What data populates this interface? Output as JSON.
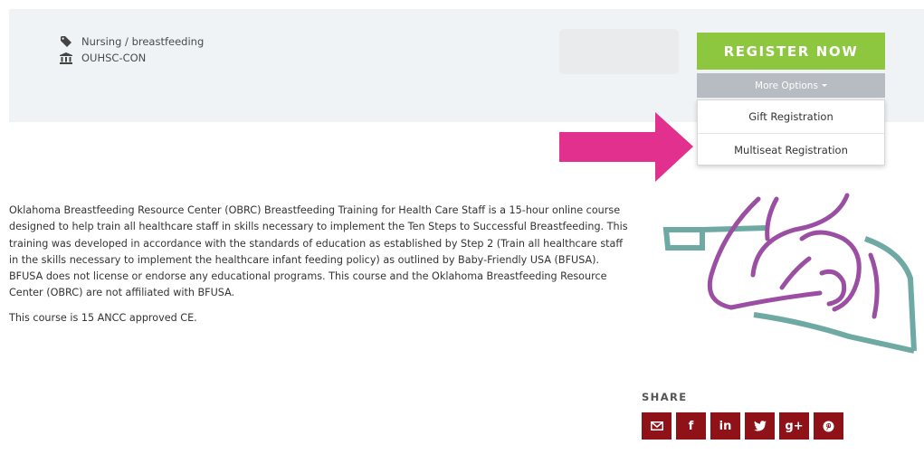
{
  "meta": {
    "category": "Nursing / breastfeeding",
    "provider": "OUHSC-CON",
    "category_icon": "tag-icon",
    "provider_icon": "institution-icon"
  },
  "actions": {
    "register_label": "REGISTER NOW",
    "more_options_label": "More Options",
    "dropdown": [
      {
        "label": "Gift Registration"
      },
      {
        "label": "Multiseat Registration"
      }
    ]
  },
  "description": {
    "paragraph1": "Oklahoma Breastfeeding Resource Center (OBRC) Breastfeeding Training for Health Care Staff is a 15-hour online course designed to help train all healthcare staff in skills necessary to implement the Ten Steps to Successful Breastfeeding. This training was developed in accordance with the standards of education as established by Step 2 (Train all healthcare staff in the skills necessary to implement the healthcare infant feeding policy) as outlined by Baby-Friendly USA (BFUSA). BFUSA does not license or endorse any educational programs. This course and the Oklahoma Breastfeeding Resource Center (OBRC) are not affiliated with BFUSA.",
    "paragraph2": "This course is 15 ANCC approved CE."
  },
  "share": {
    "label": "SHARE",
    "buttons": [
      {
        "name": "email",
        "icon": "email-icon"
      },
      {
        "name": "facebook",
        "icon": "facebook-icon",
        "glyph": "f"
      },
      {
        "name": "linkedin",
        "icon": "linkedin-icon",
        "glyph": "in"
      },
      {
        "name": "twitter",
        "icon": "twitter-icon"
      },
      {
        "name": "googleplus",
        "icon": "google-plus-icon",
        "glyph": "g+"
      },
      {
        "name": "pinterest",
        "icon": "pinterest-icon"
      }
    ]
  },
  "colors": {
    "register_green": "#8dc63f",
    "more_options_gray": "#b6bcc1",
    "arrow_pink": "#e2308f",
    "share_red": "#8e1218",
    "logo_purple": "#9b4fa2",
    "logo_teal": "#6fa9a3"
  }
}
